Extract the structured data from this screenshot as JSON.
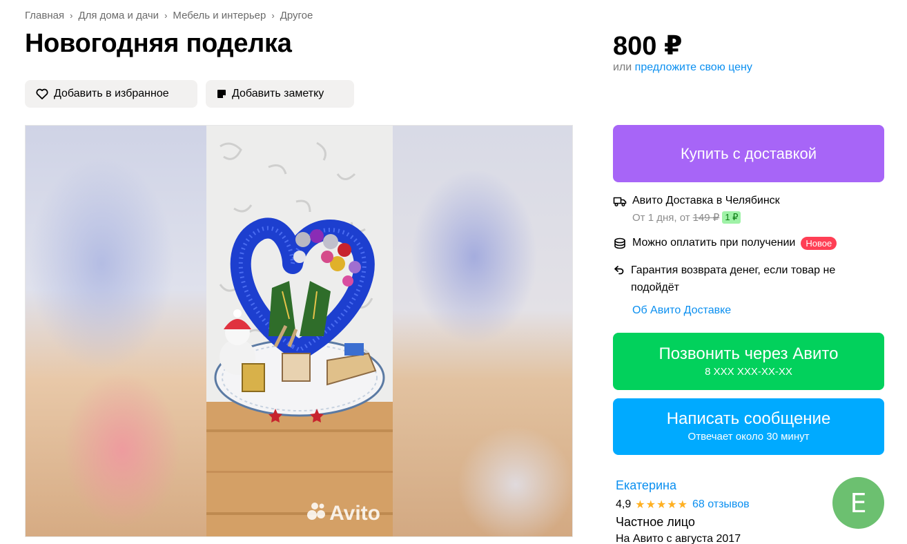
{
  "breadcrumb": [
    "Главная",
    "Для дома и дачи",
    "Мебель и интерьер",
    "Другое"
  ],
  "title": "Новогодняя поделка",
  "actions": {
    "favorite_label": "Добавить в избранное",
    "note_label": "Добавить заметку"
  },
  "gallery": {
    "watermark": "Avito"
  },
  "price": {
    "value": "800 ₽",
    "prefix": "или",
    "offer_link": "предложите свою цену"
  },
  "buy_button": "Купить с доставкой",
  "delivery": {
    "title": "Авито Доставка в Челябинск",
    "sub_prefix": "От 1 дня, от",
    "old_price": "149 ₽",
    "promo_price": "1 ₽",
    "pay_on_receipt": "Можно оплатить при получении",
    "new_badge": "Новое",
    "guarantee": "Гарантия возврата денег, если товар не подойдёт",
    "about_link": "Об Авито Доставке"
  },
  "call_button": {
    "label": "Позвонить через Авито",
    "phone": "8 XXX XXX-XX-XX"
  },
  "message_button": {
    "label": "Написать сообщение",
    "sub": "Отвечает около 30 минут"
  },
  "seller": {
    "name": "Екатерина",
    "rating": "4,9",
    "stars": "★★★★★",
    "reviews": "68 отзывов",
    "type": "Частное лицо",
    "since": "На Авито с августа 2017",
    "avatar_letter": "Е"
  },
  "colors": {
    "buy": "#a765f7",
    "call": "#02d15c",
    "message": "#00aaff",
    "link": "#0a8ff0",
    "badge": "#ff3f55",
    "avatar": "#6cc070"
  },
  "icons": [
    "chevron-right-icon",
    "heart-icon",
    "note-icon",
    "truck-icon",
    "coins-icon",
    "return-arrow-icon",
    "avito-logo-icon"
  ]
}
